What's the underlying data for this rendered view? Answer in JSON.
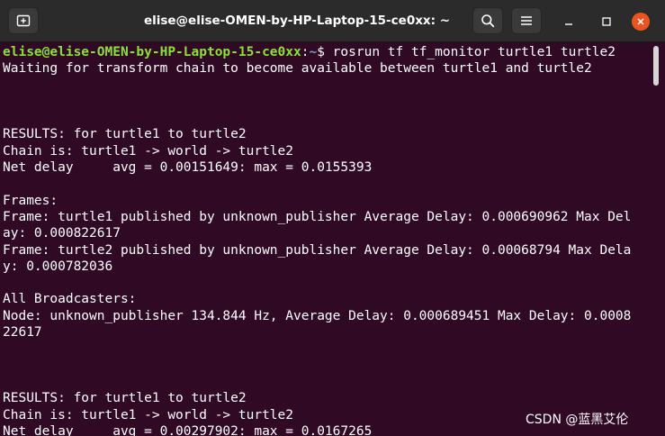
{
  "window": {
    "title": "elise@elise-OMEN-by-HP-Laptop-15-ce0xx: ~"
  },
  "icons": {
    "new_tab": "new-tab-icon",
    "search": "search-icon",
    "menu": "hamburger-menu-icon",
    "minimize": "minimize-icon",
    "maximize": "maximize-icon",
    "close": "close-icon"
  },
  "colors": {
    "terminal_bg": "#300a24",
    "prompt_user": "#8ae234",
    "prompt_path": "#729fcf",
    "close_button": "#e95420",
    "titlebar_bg": "#2b2b2b"
  },
  "prompt": {
    "user_host": "elise@elise-OMEN-by-HP-Laptop-15-ce0xx",
    "separator": ":",
    "path": "~",
    "symbol": "$ ",
    "command": "rosrun tf tf_monitor turtle1 turtle2"
  },
  "output": [
    "Waiting for transform chain to become available between turtle1 and turtle2",
    "",
    "",
    "",
    "RESULTS: for turtle1 to turtle2",
    "Chain is: turtle1 -> world -> turtle2",
    "Net delay     avg = 0.00151649: max = 0.0155393",
    "",
    "Frames:",
    "Frame: turtle1 published by unknown_publisher Average Delay: 0.000690962 Max Del",
    "ay: 0.000822617",
    "Frame: turtle2 published by unknown_publisher Average Delay: 0.00068794 Max Dela",
    "y: 0.000782036",
    "",
    "All Broadcasters:",
    "Node: unknown_publisher 134.844 Hz, Average Delay: 0.000689451 Max Delay: 0.0008",
    "22617",
    "",
    "",
    "",
    "RESULTS: for turtle1 to turtle2",
    "Chain is: turtle1 -> world -> turtle2",
    "Net delay     avg = 0.00297902: max = 0.0167265"
  ],
  "watermark": "CSDN @蓝黑艾伦"
}
